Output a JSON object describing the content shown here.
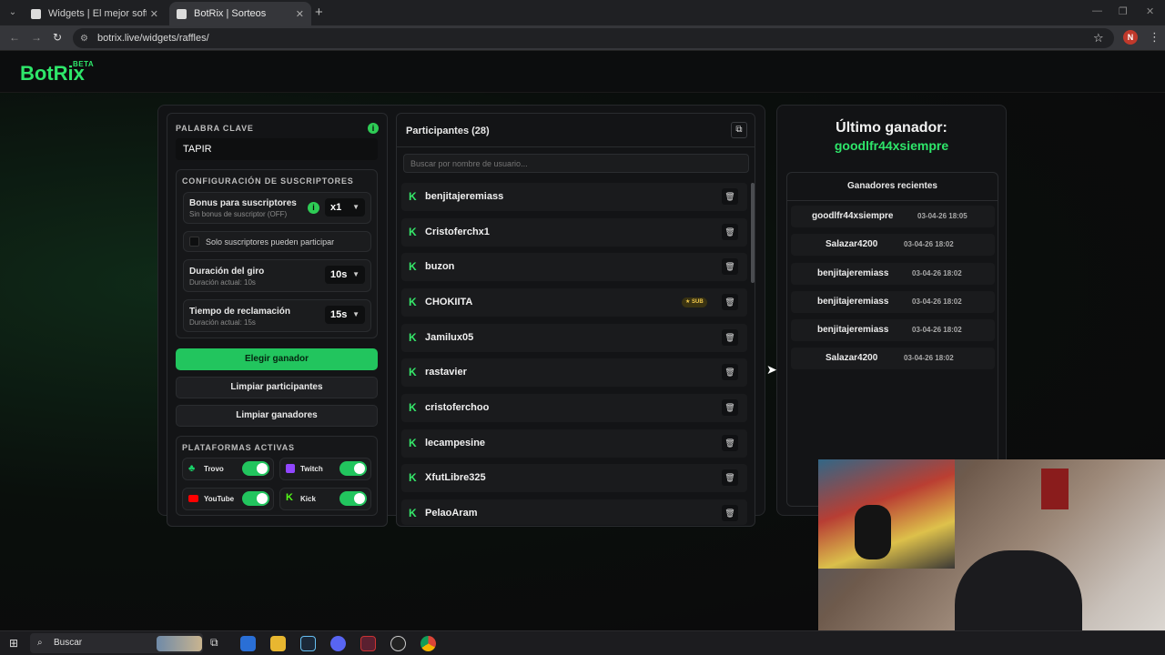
{
  "browser": {
    "tabs": [
      {
        "title": "Widgets | El mejor software para",
        "active": false
      },
      {
        "title": "BotRix | Sorteos",
        "active": true
      }
    ],
    "url": "botrix.live/widgets/raffles/",
    "profile_initial": "N"
  },
  "app": {
    "logo": "BotRix",
    "logo_badge": "BETA"
  },
  "left": {
    "keyword_label": "PALABRA CLAVE",
    "keyword_value": "TAPIR",
    "subs_config_label": "CONFIGURACIÓN DE SUSCRIPTORES",
    "bonus_title": "Bonus para suscriptores",
    "bonus_sub": "Sin bonus de suscriptor (OFF)",
    "bonus_value": "x1",
    "only_subs_label": "Solo suscriptores pueden participar",
    "spin_title": "Duración del giro",
    "spin_sub": "Duración actual: 10s",
    "spin_value": "10s",
    "claim_title": "Tiempo de reclamación",
    "claim_sub": "Duración actual: 15s",
    "claim_value": "15s",
    "pick_winner": "Elegir ganador",
    "clear_participants": "Limpiar participantes",
    "clear_winners": "Limpiar ganadores",
    "platforms_label": "PLATAFORMAS ACTIVAS",
    "platforms": [
      {
        "name": "Trovo",
        "enabled": true,
        "color": "#19d66b"
      },
      {
        "name": "Twitch",
        "enabled": true,
        "color": "#9146ff"
      },
      {
        "name": "YouTube",
        "enabled": true,
        "color": "#ff0000"
      },
      {
        "name": "Kick",
        "enabled": true,
        "color": "#53fc18"
      }
    ]
  },
  "participants": {
    "title": "Participantes (28)",
    "search_placeholder": "Buscar por nombre de usuario...",
    "sub_badge": "★ SUB",
    "items": [
      {
        "name": "benjitajeremiass",
        "sub": false
      },
      {
        "name": "Cristoferchx1",
        "sub": false
      },
      {
        "name": "buzon",
        "sub": false
      },
      {
        "name": "CHOKIITA",
        "sub": true
      },
      {
        "name": "Jamilux05",
        "sub": false
      },
      {
        "name": "rastavier",
        "sub": false
      },
      {
        "name": "cristoferchoo",
        "sub": false
      },
      {
        "name": "lecampesine",
        "sub": false
      },
      {
        "name": "XfutLibre325",
        "sub": false
      },
      {
        "name": "PelaoAram",
        "sub": false
      }
    ]
  },
  "winner": {
    "last_label": "Último ganador:",
    "last_name": "goodlfr44xsiempre",
    "recent_label": "Ganadores recientes",
    "recent": [
      {
        "name": "goodlfr44xsiempre",
        "time": "03-04-26 18:05"
      },
      {
        "name": "Salazar4200",
        "time": "03-04-26 18:02"
      },
      {
        "name": "benjitajeremiass",
        "time": "03-04-26 18:02"
      },
      {
        "name": "benjitajeremiass",
        "time": "03-04-26 18:02"
      },
      {
        "name": "benjitajeremiass",
        "time": "03-04-26 18:02"
      },
      {
        "name": "Salazar4200",
        "time": "03-04-26 18:02"
      }
    ]
  },
  "taskbar": {
    "search_label": "Buscar"
  },
  "colors": {
    "accent": "#22c55e",
    "brand": "#2ee66a"
  }
}
